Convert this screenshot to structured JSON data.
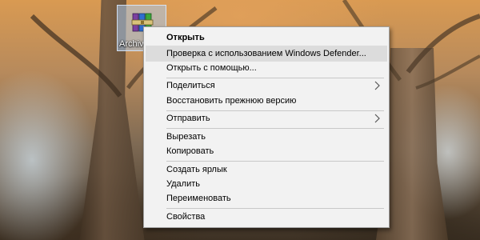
{
  "desktop": {
    "icon": {
      "label": "Archive",
      "icon_name": "winrar-archive-icon"
    }
  },
  "context_menu": {
    "items": [
      {
        "label": "Открыть",
        "bold": true
      },
      {
        "label": "Проверка с использованием Windows Defender...",
        "hovered": true
      },
      {
        "label": "Открыть с помощью..."
      },
      {
        "label": "Поделиться",
        "submenu": true
      },
      {
        "label": "Восстановить прежнюю версию"
      },
      {
        "label": "Отправить",
        "submenu": true
      },
      {
        "label": "Вырезать"
      },
      {
        "label": "Копировать"
      },
      {
        "label": "Создать ярлык"
      },
      {
        "label": "Удалить"
      },
      {
        "label": "Переименовать"
      },
      {
        "label": "Свойства"
      }
    ],
    "colors": {
      "background": "#f2f2f2",
      "hover": "#dcdcdc",
      "border": "#a0a0a0"
    }
  }
}
